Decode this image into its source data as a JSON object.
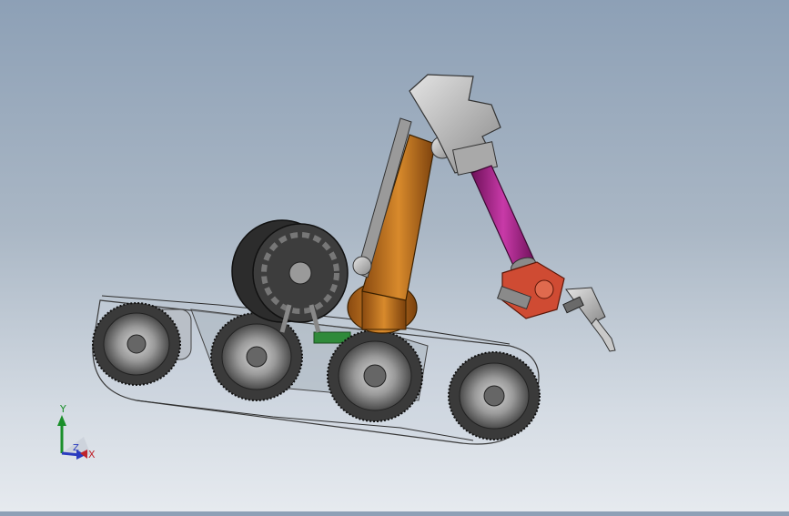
{
  "viewport": {
    "background_top": "#8da0b6",
    "background_bottom": "#e6eaef"
  },
  "model": {
    "icon": "welding-crawler-robot",
    "arm_color": "#c8781e",
    "forearm_color": "#b0268f",
    "wrist_color": "#d0442e"
  },
  "triad": {
    "x_label": "X",
    "y_label": "Y",
    "z_label": "Z",
    "x_color": "#c0242c",
    "y_color": "#1a8f2a",
    "z_color": "#2a3bbf"
  }
}
